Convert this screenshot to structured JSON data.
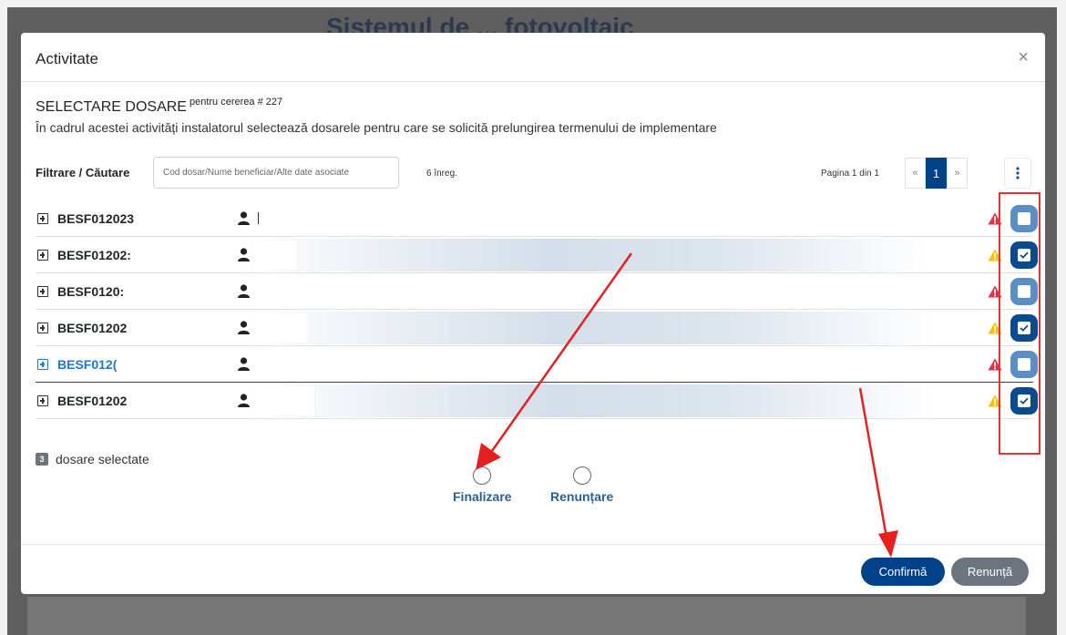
{
  "background": {
    "title": "Sistemul de ... fotovoltaic"
  },
  "modal": {
    "title": "Activitate",
    "close_label": "×",
    "selection_title": "SELECTARE DOSARE",
    "selection_sup": "pentru cererea # 227",
    "description": "În cadrul acestei activități instalatorul selectează dosarele pentru care se solicită prelungirea termenului de implementare",
    "filter": {
      "label": "Filtrare / Căutare",
      "placeholder": "Cod dosar/Nume beneficiar/Alte date asociate",
      "count": "6 înreg."
    },
    "pagination": {
      "info": "Pagina 1 din 1",
      "prev": "«",
      "current": "1",
      "next": "»"
    },
    "rows": [
      {
        "code": "BESF012023",
        "status": "error",
        "checked": false
      },
      {
        "code": "BESF01202:",
        "status": "warning",
        "checked": true
      },
      {
        "code": "BESF0120:",
        "status": "error",
        "checked": false
      },
      {
        "code": "BESF01202",
        "status": "warning",
        "checked": true
      },
      {
        "code": "BESF012(",
        "status": "error",
        "checked": false
      },
      {
        "code": "BESF01202",
        "status": "warning",
        "checked": true
      }
    ],
    "selected": {
      "count": "3",
      "label": "dosare selectate"
    },
    "options": {
      "finish": "Finalizare",
      "cancel": "Renunțare"
    },
    "footer": {
      "confirm": "Confirmă",
      "cancel": "Renunță"
    }
  },
  "colors": {
    "primary": "#00428a",
    "secondary": "#6c757d",
    "error": "#dc3545",
    "warning": "#ffc107",
    "annotation": "#e63232"
  }
}
